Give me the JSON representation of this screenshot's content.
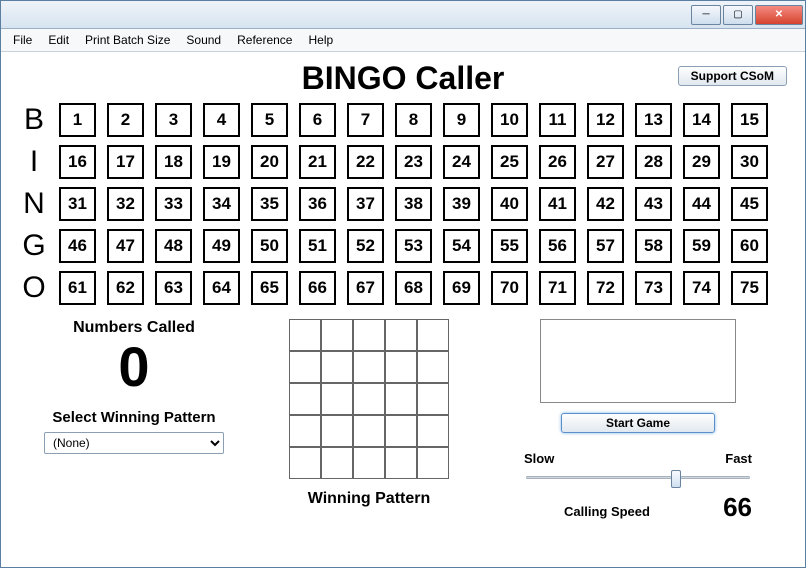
{
  "window": {
    "min": "─",
    "max": "▢",
    "close": "✕"
  },
  "menu": {
    "file": "File",
    "edit": "Edit",
    "print": "Print Batch Size",
    "sound": "Sound",
    "reference": "Reference",
    "help": "Help"
  },
  "header": {
    "title": "BINGO Caller",
    "support": "Support CSoM"
  },
  "board": {
    "rows": [
      {
        "letter": "B",
        "cells": [
          "1",
          "2",
          "3",
          "4",
          "5",
          "6",
          "7",
          "8",
          "9",
          "10",
          "11",
          "12",
          "13",
          "14",
          "15"
        ]
      },
      {
        "letter": "I",
        "cells": [
          "16",
          "17",
          "18",
          "19",
          "20",
          "21",
          "22",
          "23",
          "24",
          "25",
          "26",
          "27",
          "28",
          "29",
          "30"
        ]
      },
      {
        "letter": "N",
        "cells": [
          "31",
          "32",
          "33",
          "34",
          "35",
          "36",
          "37",
          "38",
          "39",
          "40",
          "41",
          "42",
          "43",
          "44",
          "45"
        ]
      },
      {
        "letter": "G",
        "cells": [
          "46",
          "47",
          "48",
          "49",
          "50",
          "51",
          "52",
          "53",
          "54",
          "55",
          "56",
          "57",
          "58",
          "59",
          "60"
        ]
      },
      {
        "letter": "O",
        "cells": [
          "61",
          "62",
          "63",
          "64",
          "65",
          "66",
          "67",
          "68",
          "69",
          "70",
          "71",
          "72",
          "73",
          "74",
          "75"
        ]
      }
    ]
  },
  "stats": {
    "numbers_called_label": "Numbers Called",
    "numbers_called_value": "0",
    "select_pattern_label": "Select Winning Pattern",
    "pattern_value": "(None)"
  },
  "pattern": {
    "winning_label": "Winning Pattern",
    "rows": 5,
    "cols": 5
  },
  "controls": {
    "start": "Start Game",
    "slow": "Slow",
    "fast": "Fast",
    "speed_caption": "Calling Speed",
    "speed_value": "66",
    "slider_percent": 66
  }
}
